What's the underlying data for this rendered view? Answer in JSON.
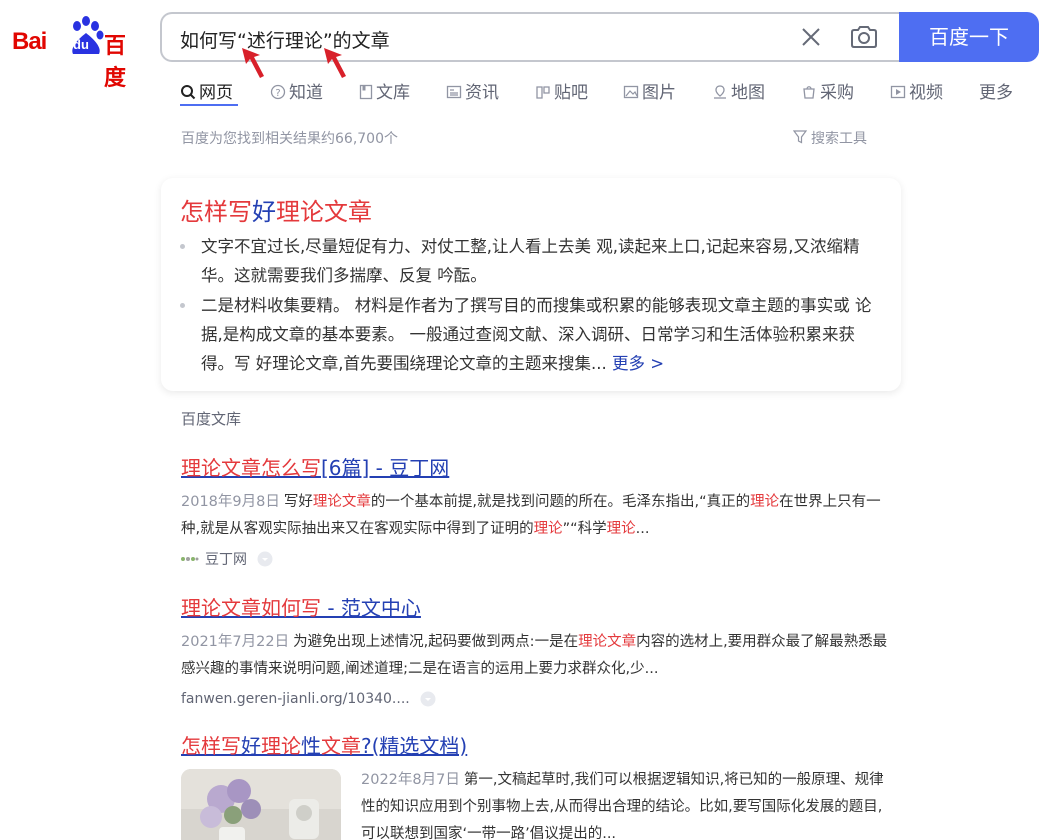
{
  "logo": {
    "latin": "Bai",
    "du": "du",
    "chinese": "百度",
    "brand_color": "#e10601"
  },
  "search": {
    "query": "如何写“述行理论”的文章",
    "button_label": "百度一下"
  },
  "tabs": [
    {
      "label": "网页",
      "icon": "search-icon"
    },
    {
      "label": "知道",
      "icon": "question-icon"
    },
    {
      "label": "文库",
      "icon": "document-icon"
    },
    {
      "label": "资讯",
      "icon": "news-icon"
    },
    {
      "label": "贴吧",
      "icon": "tieba-icon"
    },
    {
      "label": "图片",
      "icon": "image-icon"
    },
    {
      "label": "地图",
      "icon": "map-icon"
    },
    {
      "label": "采购",
      "icon": "purchase-icon"
    },
    {
      "label": "视频",
      "icon": "video-icon"
    },
    {
      "label": "更多"
    }
  ],
  "result_count": "百度为您找到相关结果约66,700个",
  "search_tools": "搜索工具",
  "card": {
    "title_a": "怎样写",
    "title_b": "好",
    "title_c": "理论文章",
    "bullet1": "文字不宜过长,尽量短促有力、对仗工整,让人看上去美 观,读起来上口,记起来容易,又浓缩精华。这就需要我们多揣摩、反复 吟酝。",
    "bullet2": "二是材料收集要精。 材料是作者为了撰写目的而搜集或积累的能够表现文章主题的事实或 论据,是构成文章的基本要素。 一般通过查阅文献、深入调研、日常学习和生活体验积累来获得。写 好理论文章,首先要围绕理论文章的主题来搜集...",
    "more": "更多 >"
  },
  "source_label": "百度文库",
  "results": [
    {
      "title_red": "理论文章怎么写",
      "title_blue": "[6篇] - 豆丁网",
      "date": "2018年9月8日",
      "s1": "写好",
      "s2": "理论文章",
      "s3": "的一个基本前提,就是找到问题的所在。毛泽东指出,“真正的",
      "s4": "理论",
      "s5": "在世界上只有一种,就是从客观实际抽出来又在客观实际中得到了证明的",
      "s6": "理论",
      "s7": "”“科学",
      "s8": "理论",
      "s9": "...",
      "source": "豆丁网"
    },
    {
      "title_red": "理论文章如何写",
      "title_blue": " - 范文中心",
      "date": "2021年7月22日",
      "s1": "为避免出现上述情况,起码要做到两点:一是在",
      "s2": "理论文章",
      "s3": "内容的选材上,要用群众最了解最熟悉最感兴趣的事情来说明问题,阐述道理;二是在语言的运用上要力求群众化,少...",
      "source": "fanwen.geren-jianli.org/10340...."
    },
    {
      "t1": "怎样写",
      "t2": "好",
      "t3": "理论",
      "t4": "性",
      "t5": "文章",
      "t6": "?(精选文档)",
      "date": "2022年8月7日",
      "snippet": "第一,文稿起草时,我们可以根据逻辑知识,将已知的一般原理、规律性的知识应用到个别事物上去,从而得出合理的结论。比如,要写国际化发展的题目,可以联想到国家‘一带一路’倡议提出的..."
    }
  ],
  "colors": {
    "accent": "#4e6ef2",
    "link": "#2440b3",
    "highlight": "#e4393c",
    "arrow": "#d8202a"
  }
}
